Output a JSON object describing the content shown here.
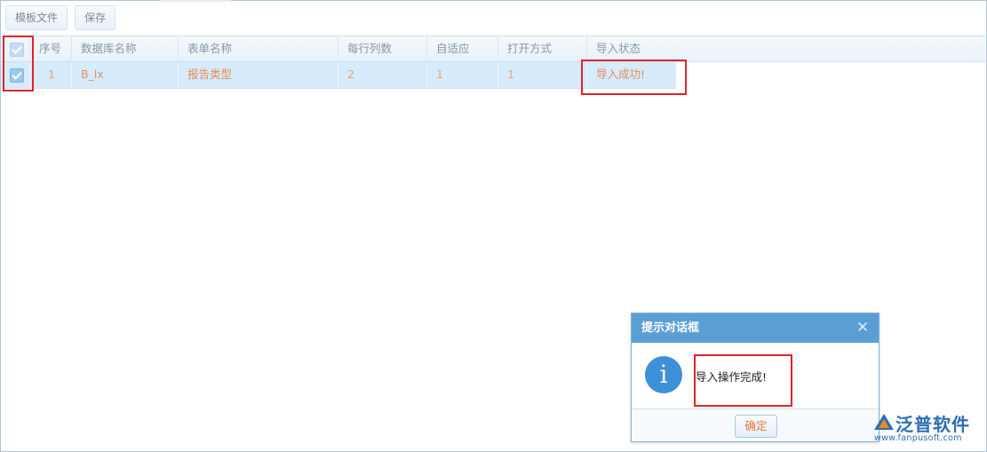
{
  "toolbar": {
    "template_file_label": "模板文件",
    "save_label": "保存"
  },
  "grid": {
    "header_checked": true,
    "columns": [
      "序号",
      "数据库名称",
      "表单名称",
      "每行列数",
      "自适应",
      "打开方式",
      "导入状态"
    ],
    "rows": [
      {
        "checked": true,
        "cells": [
          "1",
          "B_lx",
          "报告类型",
          "2",
          "1",
          "1",
          "导入成功!"
        ]
      }
    ]
  },
  "dialog": {
    "title": "提示对话框",
    "close_glyph": "✕",
    "icon_glyph": "i",
    "message": "导入操作完成!",
    "ok_label": "确定"
  },
  "logo": {
    "brand": "泛普软件",
    "url": "www.fanpusoft.com"
  },
  "colors": {
    "dialog_title_bg": "#5a9fd4",
    "selected_row_bg": "#d6ebfb",
    "row_text": "#e58d5a",
    "highlight_box": "#e0232c",
    "info_icon": "#3d8fd8"
  }
}
